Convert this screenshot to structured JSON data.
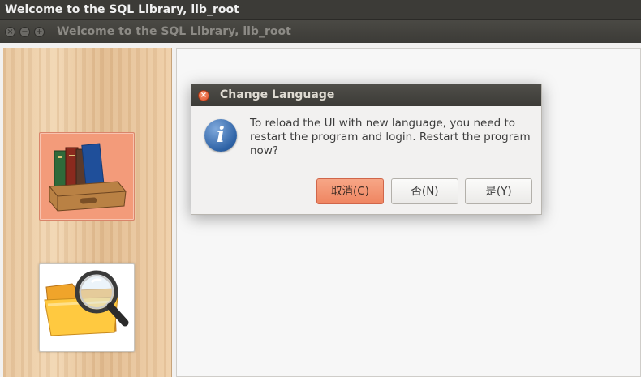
{
  "app": {
    "top_title": "Welcome to the SQL Library, lib_root",
    "window_title": "Welcome to the SQL Library, lib_root"
  },
  "window_controls": {
    "close": "×",
    "minimize": "−",
    "maximize": "+"
  },
  "sidebar": {
    "items": [
      {
        "name": "books",
        "icon": "books-in-tray-icon"
      },
      {
        "name": "search",
        "icon": "folder-magnifier-icon"
      }
    ]
  },
  "dialog": {
    "title": "Change Language",
    "close_glyph": "×",
    "icon": "i",
    "message": "To reload the UI with new language, you need to restart the program and login. Restart the program now?",
    "buttons": {
      "cancel": "取消(C)",
      "no": "否(N)",
      "yes": "是(Y)"
    }
  },
  "colors": {
    "accent_button": "#ef8561",
    "titlebar": "#3c3b37",
    "info_blue": "#2e62a5"
  }
}
